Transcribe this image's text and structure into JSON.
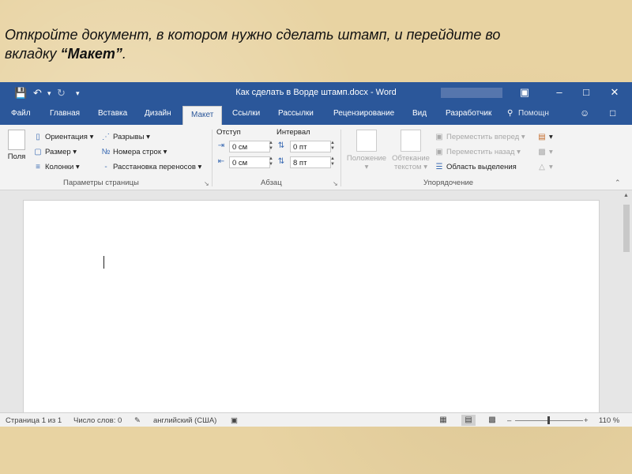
{
  "instruction": {
    "line1": "Откройте документ, в котором нужно сделать штамп, и перейдите во",
    "line2_prefix": "вкладку ",
    "line2_bold": "“Макет”",
    "line2_suffix": "."
  },
  "titlebar": {
    "title": "Как сделать в Ворде штамп.docx - Word"
  },
  "tabs": [
    {
      "label": "Файл"
    },
    {
      "label": "Главная"
    },
    {
      "label": "Вставка"
    },
    {
      "label": "Дизайн"
    },
    {
      "label": "Макет",
      "active": true
    },
    {
      "label": "Ссылки"
    },
    {
      "label": "Рассылки"
    },
    {
      "label": "Рецензирование"
    },
    {
      "label": "Вид"
    },
    {
      "label": "Разработчик"
    },
    {
      "label": "Помощн"
    }
  ],
  "ribbon": {
    "page_setup": {
      "margins": "Поля",
      "orientation": "Ориентация",
      "size": "Размер",
      "columns": "Колонки",
      "breaks": "Разрывы",
      "line_numbers": "Номера строк",
      "hyphenation": "Расстановка переносов",
      "group_label": "Параметры страницы"
    },
    "paragraph": {
      "indent_label": "Отступ",
      "spacing_label": "Интервал",
      "indent_left": "0 см",
      "indent_right": "0 см",
      "spacing_before": "0 пт",
      "spacing_after": "8 пт",
      "group_label": "Абзац"
    },
    "arrange": {
      "position": "Положение",
      "wrap_line1": "Обтекание",
      "wrap_line2": "текстом",
      "bring_forward": "Переместить вперед",
      "send_backward": "Переместить назад",
      "selection_pane": "Область выделения",
      "group_label": "Упорядочение"
    }
  },
  "statusbar": {
    "page": "Страница 1 из 1",
    "words": "Число слов: 0",
    "language": "английский (США)",
    "zoom": "110 %"
  },
  "colors": {
    "accent": "#2b579a",
    "background": "#e8d3a2"
  }
}
